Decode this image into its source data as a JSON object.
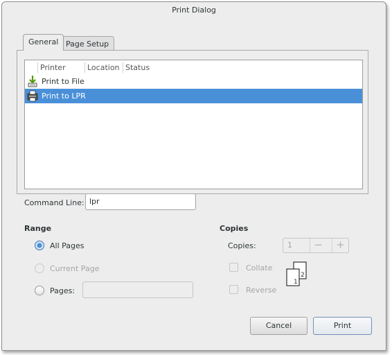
{
  "window": {
    "title": "Print Dialog"
  },
  "tabs": [
    {
      "label": "General",
      "active": true
    },
    {
      "label": "Page Setup",
      "active": false
    }
  ],
  "printer_list": {
    "columns": [
      "Printer",
      "Location",
      "Status"
    ],
    "rows": [
      {
        "name": "Print to File",
        "icon": "print-to-file-icon",
        "selected": false
      },
      {
        "name": "Print to LPR",
        "icon": "printer-icon",
        "selected": true
      }
    ],
    "selection_color": "#4a90d9"
  },
  "command_line": {
    "label": "Command Line:",
    "value": "lpr"
  },
  "range": {
    "heading": "Range",
    "options": [
      {
        "label": "All Pages",
        "checked": true,
        "enabled": true
      },
      {
        "label": "Current Page",
        "checked": false,
        "enabled": false
      },
      {
        "label": "Pages:",
        "checked": false,
        "enabled": true
      }
    ],
    "pages_value": ""
  },
  "copies": {
    "heading": "Copies",
    "label": "Copies:",
    "value": "1",
    "minus": "−",
    "plus": "+",
    "collate_label": "Collate",
    "reverse_label": "Reverse",
    "collate_icon_pages": [
      "1",
      "2"
    ]
  },
  "buttons": {
    "cancel": "Cancel",
    "print": "Print"
  }
}
